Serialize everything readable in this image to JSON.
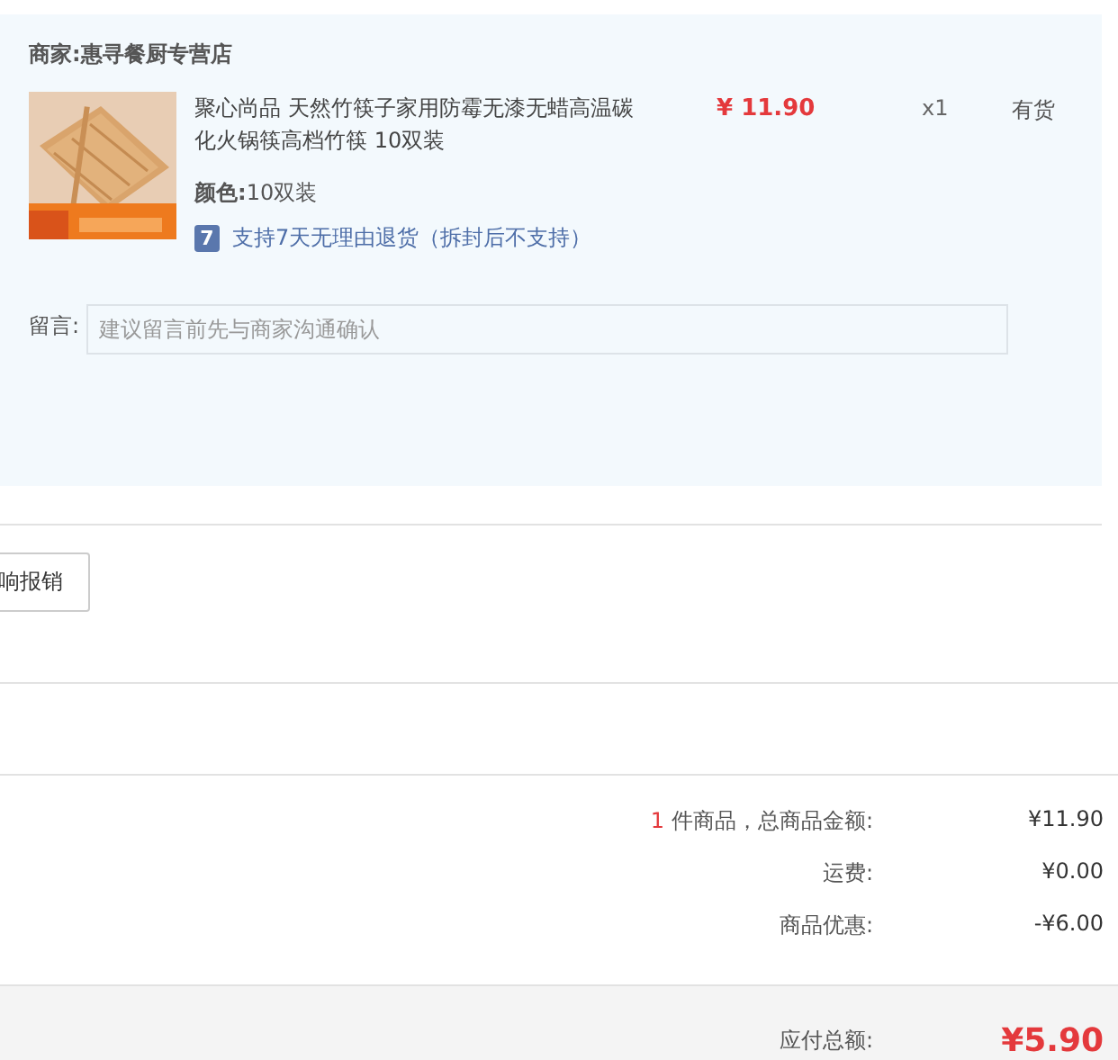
{
  "shop": {
    "label": "商家:",
    "name": "惠寻餐厨专营店"
  },
  "item": {
    "title": "聚心尚品 天然竹筷子家用防霉无漆无蜡高温碳化火锅筷高档竹筷 10双装",
    "price": "¥ 11.90",
    "qty": "x1",
    "stock": "有货",
    "spec_label": "颜色:",
    "spec_value": "10双装",
    "return_badge": "7",
    "return_text": "支持7天无理由退货（拆封后不支持）"
  },
  "message": {
    "label": "留言:",
    "placeholder": "建议留言前先与商家沟通确认"
  },
  "invoice_button": "响报销",
  "summary": [
    {
      "count": "1",
      "label": "件商品，总商品金额:",
      "value": "¥11.90"
    },
    {
      "label": "运费:",
      "value": "¥0.00"
    },
    {
      "label": "商品优惠:",
      "value": "-¥6.00"
    }
  ],
  "total": {
    "label": "应付总额:",
    "value": "¥5.90"
  }
}
